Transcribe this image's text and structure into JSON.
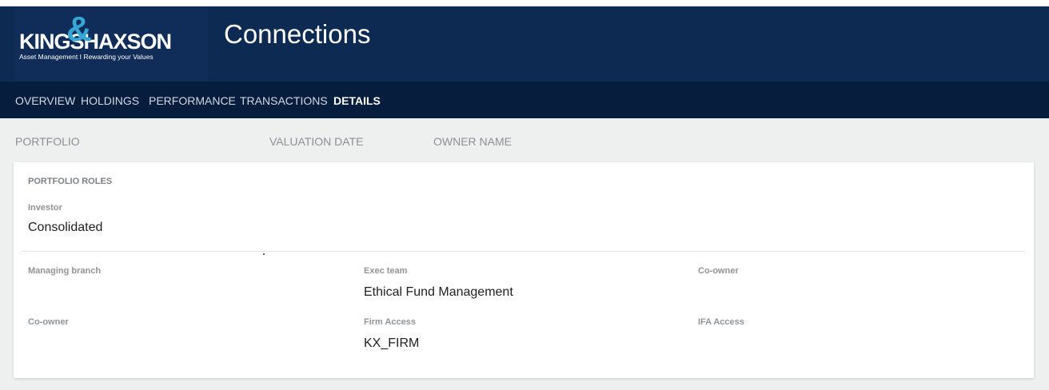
{
  "brand": {
    "logo_left": "KING",
    "logo_amp": "&",
    "logo_right": "SHAXSON",
    "tagline": "Asset Management I Rewarding your Values",
    "accent_color": "#36a6d4",
    "header_color": "#0d2a53"
  },
  "header": {
    "title": "Connections"
  },
  "nav": {
    "tabs": [
      "OVERVIEW",
      "HOLDINGS",
      "PERFORMANCE",
      "TRANSACTIONS",
      "DETAILS"
    ],
    "active": "DETAILS"
  },
  "info_bar": {
    "portfolio_label": "PORTFOLIO",
    "valuation_date_label": "VALUATION DATE",
    "owner_name_label": "OWNER NAME"
  },
  "roles": {
    "section_title": "PORTFOLIO ROLES",
    "investor_label": "Investor",
    "investor_value": "Consolidated",
    "managing_branch_label": "Managing branch",
    "exec_team_label": "Exec team",
    "exec_team_value": "Ethical Fund Management",
    "co_owner_label_1": "Co-owner",
    "co_owner_label_2": "Co-owner",
    "firm_access_label": "Firm Access",
    "firm_access_value": "KX_FIRM",
    "ifa_access_label": "IFA Access"
  }
}
